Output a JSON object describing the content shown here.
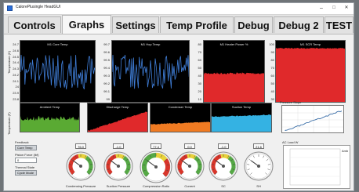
{
  "window": {
    "title": "CalorePlusingle HeadGUI",
    "controls": {
      "minimize": "–",
      "maximize": "□",
      "close": "✕"
    }
  },
  "tabs": [
    {
      "label": "Controls",
      "active": false
    },
    {
      "label": "Graphs",
      "active": true
    },
    {
      "label": "Settings",
      "active": false
    },
    {
      "label": "Temp Profile",
      "active": false
    },
    {
      "label": "Debug",
      "active": false
    },
    {
      "label": "Debug 2",
      "active": false
    },
    {
      "label": "TEST",
      "active": false
    }
  ],
  "plots_row1": {
    "y_axis_label": "Temperature (C)",
    "y_ticks": [
      "24.7",
      "24.6",
      "24.5",
      "24.4",
      "24.3",
      "24.2",
      "24.1",
      "24",
      "23.9",
      "23.8"
    ],
    "plot2_y_ticks": [
      "99.7",
      "99.6",
      "99.5",
      "99.4",
      "99.3",
      "99.2",
      "99.1",
      "99"
    ],
    "plot3_y_ticks": [
      "80",
      "70",
      "60",
      "50",
      "40",
      "30",
      "20",
      "10"
    ],
    "plot4_y_ticks": [
      "100",
      "90",
      "80",
      "70",
      "60",
      "50",
      "40",
      "30"
    ],
    "titles": [
      "M1 Core Temp",
      "M1 Hop Temp",
      "M1 Heater Power %",
      "M1 SCR Temp"
    ],
    "colors": [
      "#3f7dd6",
      "#3f7dd6",
      "#e0292b",
      "#e0292b"
    ]
  },
  "plots_row2": {
    "y_axis_label": "Temperature (F)",
    "titles": [
      "Ambient Temp",
      "Discharge Temp",
      "Condenser Temp",
      "Suction Temp",
      "Pressure Slope"
    ],
    "colors": [
      "#5aaa33",
      "#e0292b",
      "#f07b22",
      "#34b2e3",
      "#3a6ea8"
    ]
  },
  "left_panel": {
    "feedback_label": "Feedback",
    "feedback_value": "Core Temp",
    "piston_label": "Piston Force (lbf)",
    "piston_value": "0",
    "thermal_label": "Thermal State",
    "thermal_value": "Cycle Mode"
  },
  "gauges": [
    {
      "value": "76.0",
      "label": "Condensing Pressure"
    },
    {
      "value": "-1.0",
      "label": "Suction Pressure"
    },
    {
      "value": "77.4",
      "label": "Compression Ratio"
    },
    {
      "value": "0.0",
      "label": "Current"
    },
    {
      "value": "-1.0",
      "label": "SC"
    },
    {
      "value": "21.6",
      "label": "SH"
    }
  ],
  "ac_load": {
    "title": "AC Load W",
    "legend": "Amb"
  }
}
